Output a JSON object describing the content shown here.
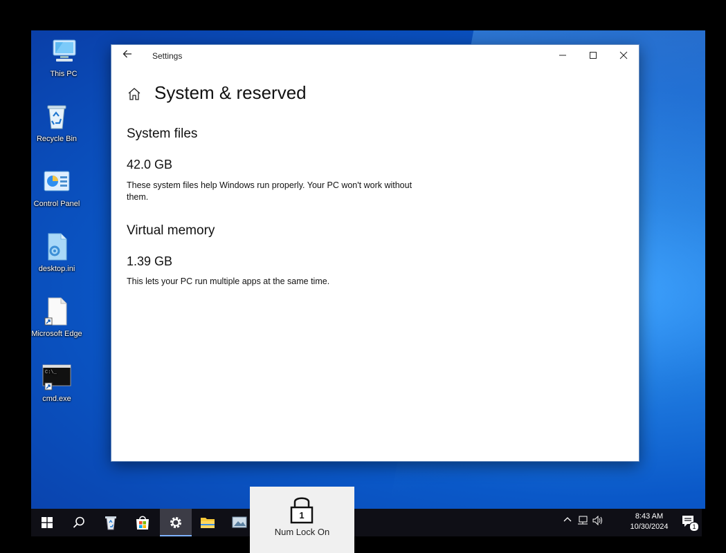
{
  "desktop": {
    "icons": [
      {
        "label": "This PC",
        "icon": "computer-icon"
      },
      {
        "label": "Recycle Bin",
        "icon": "recycle-bin-icon"
      },
      {
        "label": "Control Panel",
        "icon": "control-panel-icon"
      },
      {
        "label": "desktop.ini",
        "icon": "settings-file-icon"
      },
      {
        "label": "Microsoft Edge",
        "icon": "shortcut-file-icon"
      },
      {
        "label": "cmd.exe",
        "icon": "terminal-icon"
      }
    ]
  },
  "window": {
    "title": "Settings",
    "page_title": "System & reserved",
    "sections": [
      {
        "heading": "System files",
        "value": "42.0 GB",
        "description": "These system files help Windows run properly. Your PC won't work without them."
      },
      {
        "heading": "Virtual memory",
        "value": "1.39 GB",
        "description": "This lets your PC run multiple apps at the same time."
      }
    ]
  },
  "taskbar": {
    "pinned": [
      "start-icon",
      "search-icon",
      "recycle-icon",
      "store-icon",
      "settings-icon",
      "file-explorer-icon",
      "photos-icon"
    ],
    "active": "settings-icon",
    "clock": {
      "time": "8:43 AM",
      "date": "10/30/2024"
    },
    "notification_count": "1"
  },
  "osd": {
    "label": "Num Lock On",
    "badge": "1"
  },
  "colors": {
    "desktop_blue": "#0a58c8",
    "taskbar": "#0f0f16",
    "accent": "#7fb3ff"
  }
}
